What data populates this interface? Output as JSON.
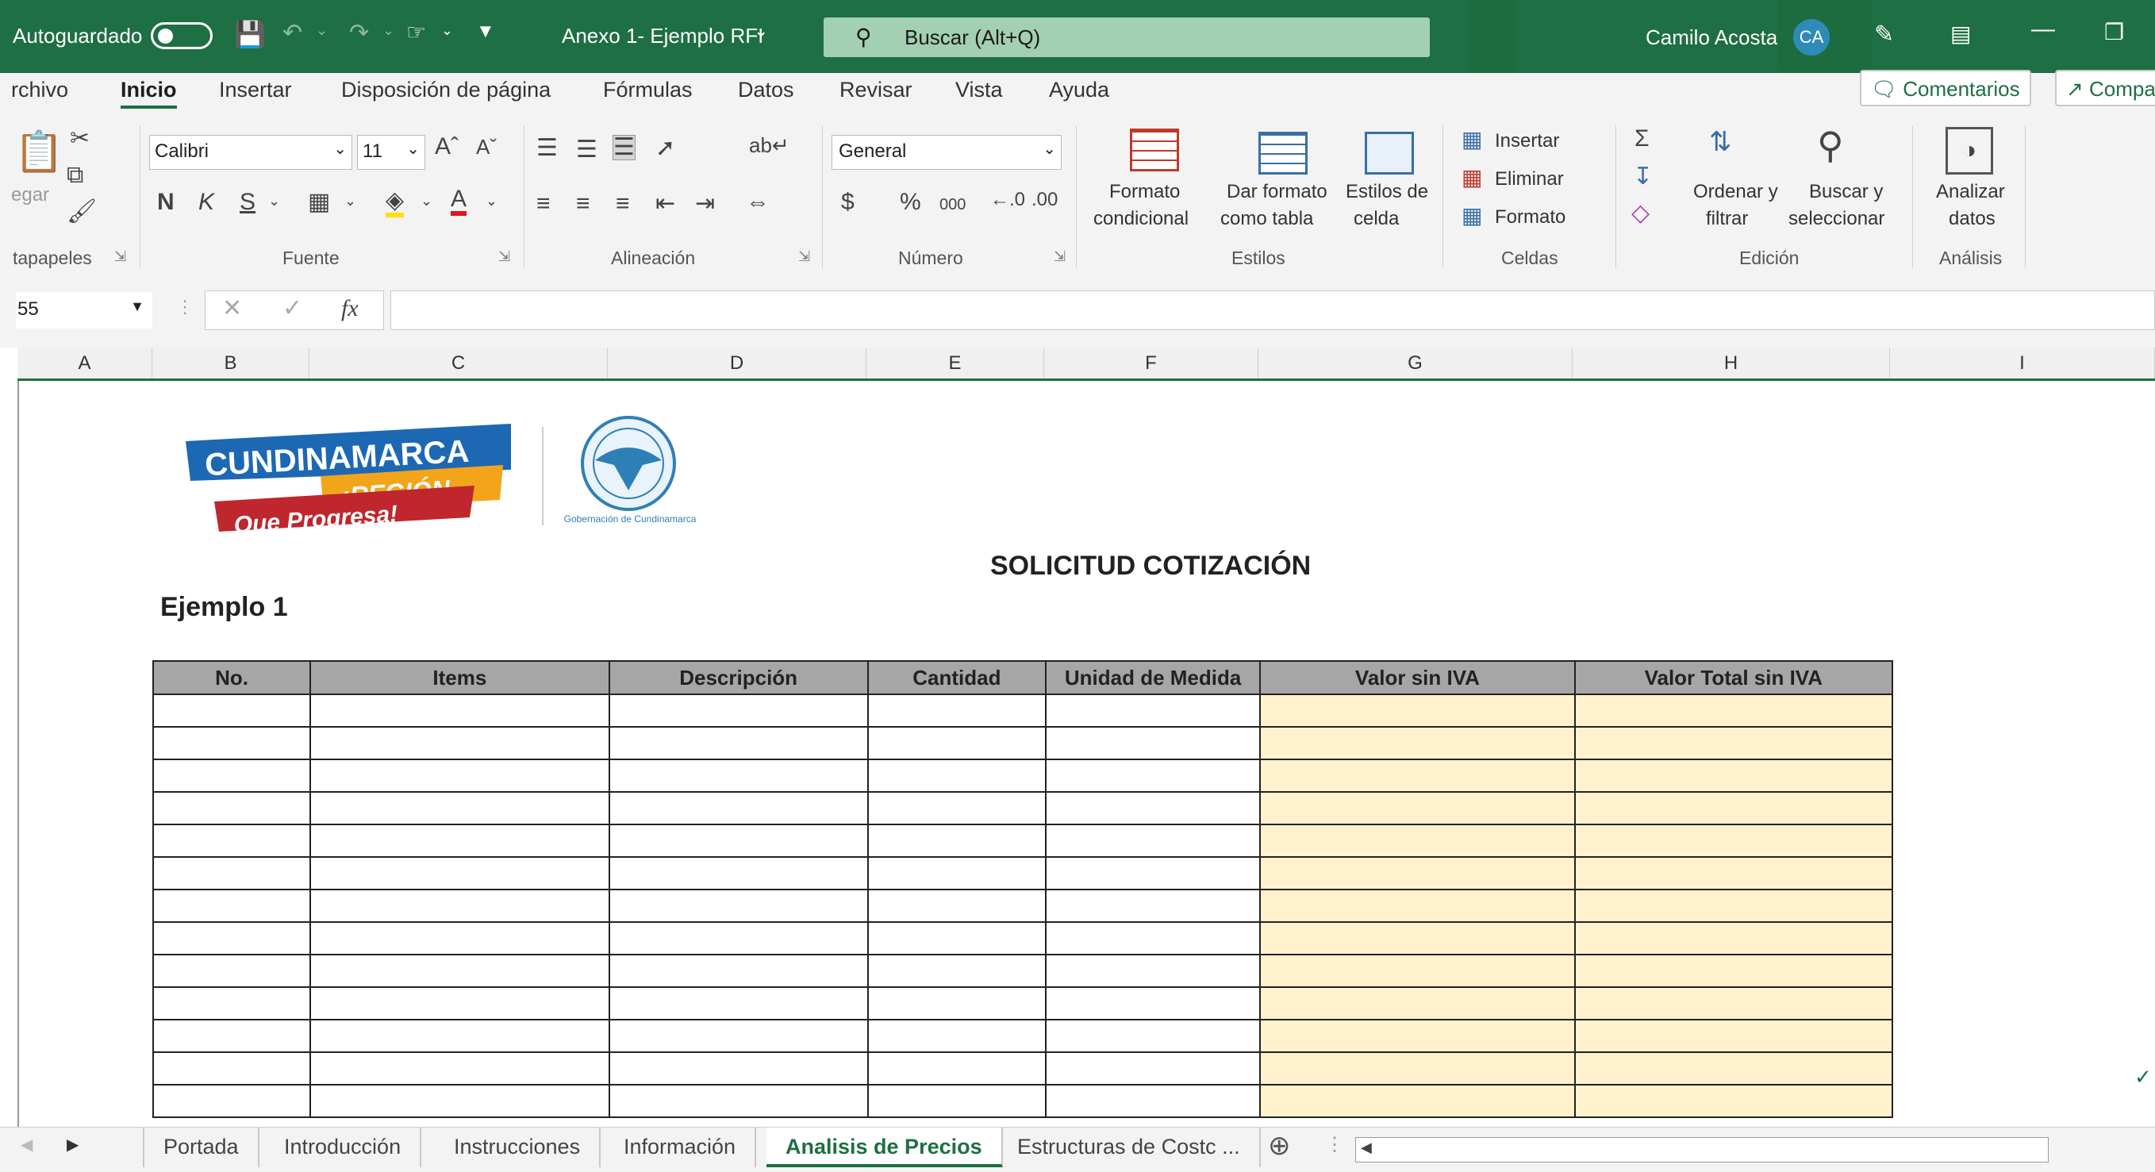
{
  "titlebar": {
    "autosave_label": "Autoguardado",
    "file_name": "Anexo 1- Ejemplo RFI",
    "search_placeholder": "Buscar (Alt+Q)",
    "user_name": "Camilo Acosta",
    "user_initials": "CA"
  },
  "ribbon_tabs": [
    "rchivo",
    "Inicio",
    "Insertar",
    "Disposición de página",
    "Fórmulas",
    "Datos",
    "Revisar",
    "Vista",
    "Ayuda"
  ],
  "ribbon_buttons": {
    "comments": "Comentarios",
    "share": "Compa"
  },
  "ribbon": {
    "clipboard": {
      "paste": "egar",
      "label": "tapapeles"
    },
    "font": {
      "name": "Calibri",
      "size": "11",
      "bold": "N",
      "italic": "K",
      "underline": "S",
      "label": "Fuente"
    },
    "alignment": {
      "label": "Alineación"
    },
    "number": {
      "format": "General",
      "label": "Número",
      "currency": "$",
      "percent": "%",
      "thousands": "000"
    },
    "styles": {
      "conditional_1": "Formato",
      "conditional_2": "condicional",
      "table_1": "Dar formato",
      "table_2": "como tabla",
      "cell_1": "Estilos de",
      "cell_2": "celda",
      "label": "Estilos"
    },
    "cells": {
      "insert": "Insertar",
      "delete": "Eliminar",
      "format": "Formato",
      "label": "Celdas"
    },
    "editing": {
      "sort_1": "Ordenar y",
      "sort_2": "filtrar",
      "find_1": "Buscar y",
      "find_2": "seleccionar",
      "label": "Edición"
    },
    "analysis": {
      "btn_1": "Analizar",
      "btn_2": "datos",
      "label": "Análisis"
    }
  },
  "formula_bar": {
    "name_box": "55",
    "content": ""
  },
  "columns": [
    "A",
    "B",
    "C",
    "D",
    "E",
    "F",
    "G",
    "H",
    "I"
  ],
  "sheet": {
    "logo": {
      "line1": "CUNDINAMARCA",
      "line2": "¡REGIÓN",
      "line3": "Que Progresa!",
      "seal_caption": "Gobernación de Cundinamarca"
    },
    "title": "SOLICITUD COTIZACIÓN",
    "subtitle": "Ejemplo 1",
    "table_headers": [
      "No.",
      "Items",
      "Descripción",
      "Cantidad",
      "Unidad de Medida",
      "Valor sin IVA",
      "Valor Total sin IVA"
    ]
  },
  "sheet_tabs": [
    "Portada",
    "Introducción",
    "Instrucciones",
    "Información",
    "Analisis de Precios",
    "Estructuras de Costc ..."
  ],
  "active_sheet": "Analisis de Precios",
  "colors": {
    "excel_green": "#1e6f43",
    "header_gray": "#a6a6a6",
    "value_yellow": "#fff2cc"
  }
}
